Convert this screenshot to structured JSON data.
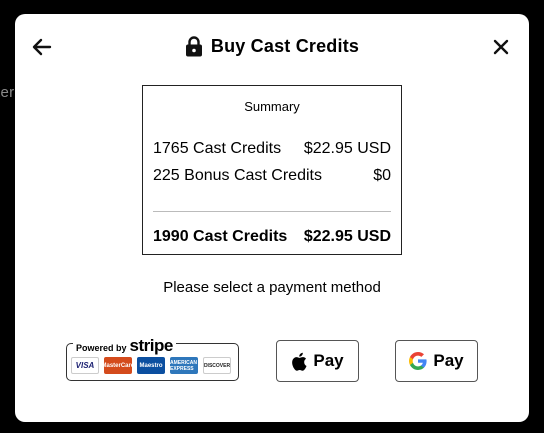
{
  "background": {
    "peek_text": "ter"
  },
  "header": {
    "title": "Buy Cast Credits",
    "back_icon": "arrow-left-icon",
    "lock_icon": "lock-icon",
    "close_icon": "close-icon"
  },
  "summary": {
    "title": "Summary",
    "rows": [
      {
        "label": "1765 Cast Credits",
        "value": "$22.95 USD"
      },
      {
        "label": "225 Bonus Cast Credits",
        "value": "$0"
      }
    ],
    "total": {
      "label": "1990 Cast Credits",
      "value": "$22.95 USD"
    }
  },
  "payment": {
    "prompt": "Please select a payment method",
    "stripe": {
      "powered_by": "Powered by",
      "brand": "stripe",
      "cards": [
        "VISA",
        "MasterCard",
        "Maestro",
        "AMERICAN EXPRESS",
        "DISCOVER"
      ]
    },
    "apple_pay_label": "Pay",
    "google_pay_label": "Pay"
  },
  "colors": {
    "backdrop": "#000000",
    "modal": "#ffffff",
    "text": "#000000"
  }
}
